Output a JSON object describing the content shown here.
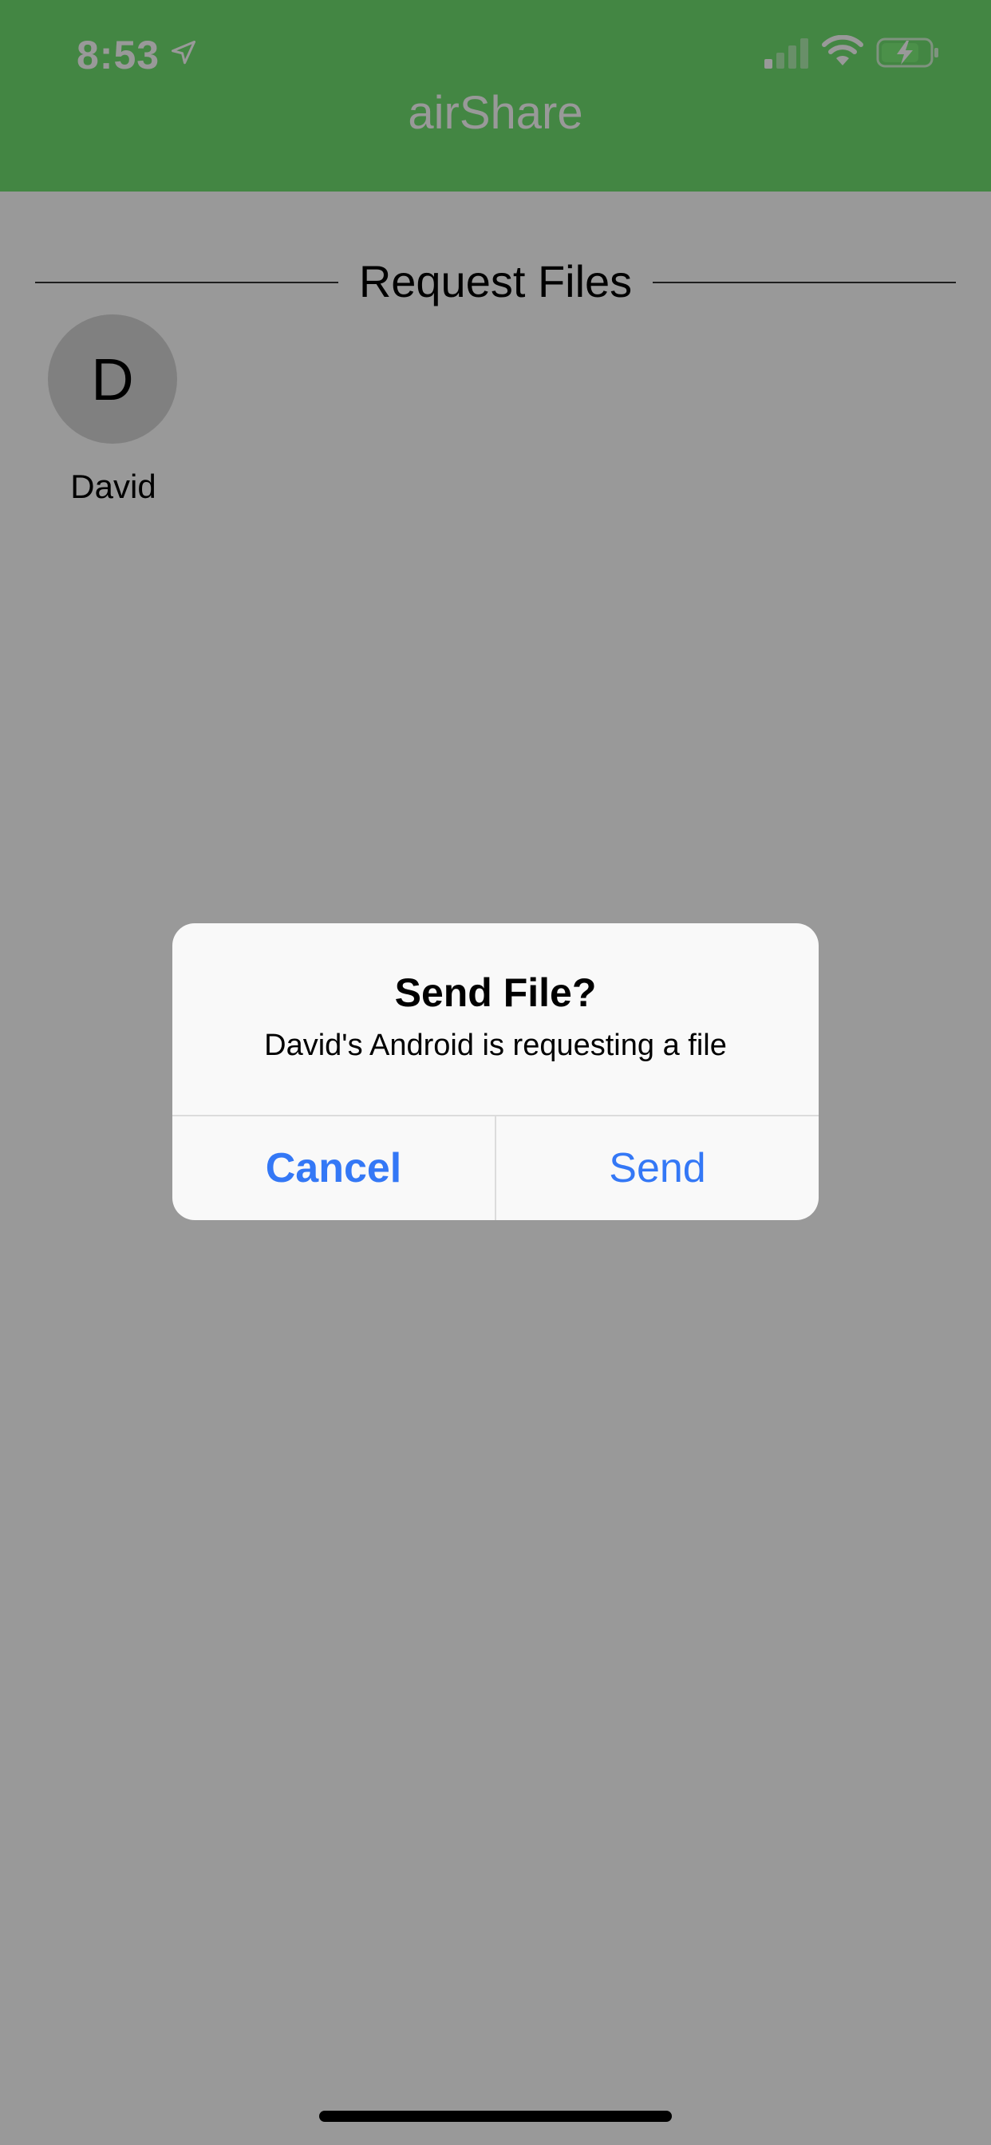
{
  "status_bar": {
    "time": "8:53"
  },
  "header": {
    "title": "airShare"
  },
  "section": {
    "title": "Request Files"
  },
  "devices": [
    {
      "initial": "D",
      "name": "David"
    }
  ],
  "alert": {
    "title": "Send File?",
    "message": "David's Android is requesting a file",
    "cancel_label": "Cancel",
    "send_label": "Send"
  },
  "colors": {
    "header_bg": "#70e070",
    "accent": "#3478f6",
    "overlay": "rgba(0,0,0,0.4)"
  }
}
